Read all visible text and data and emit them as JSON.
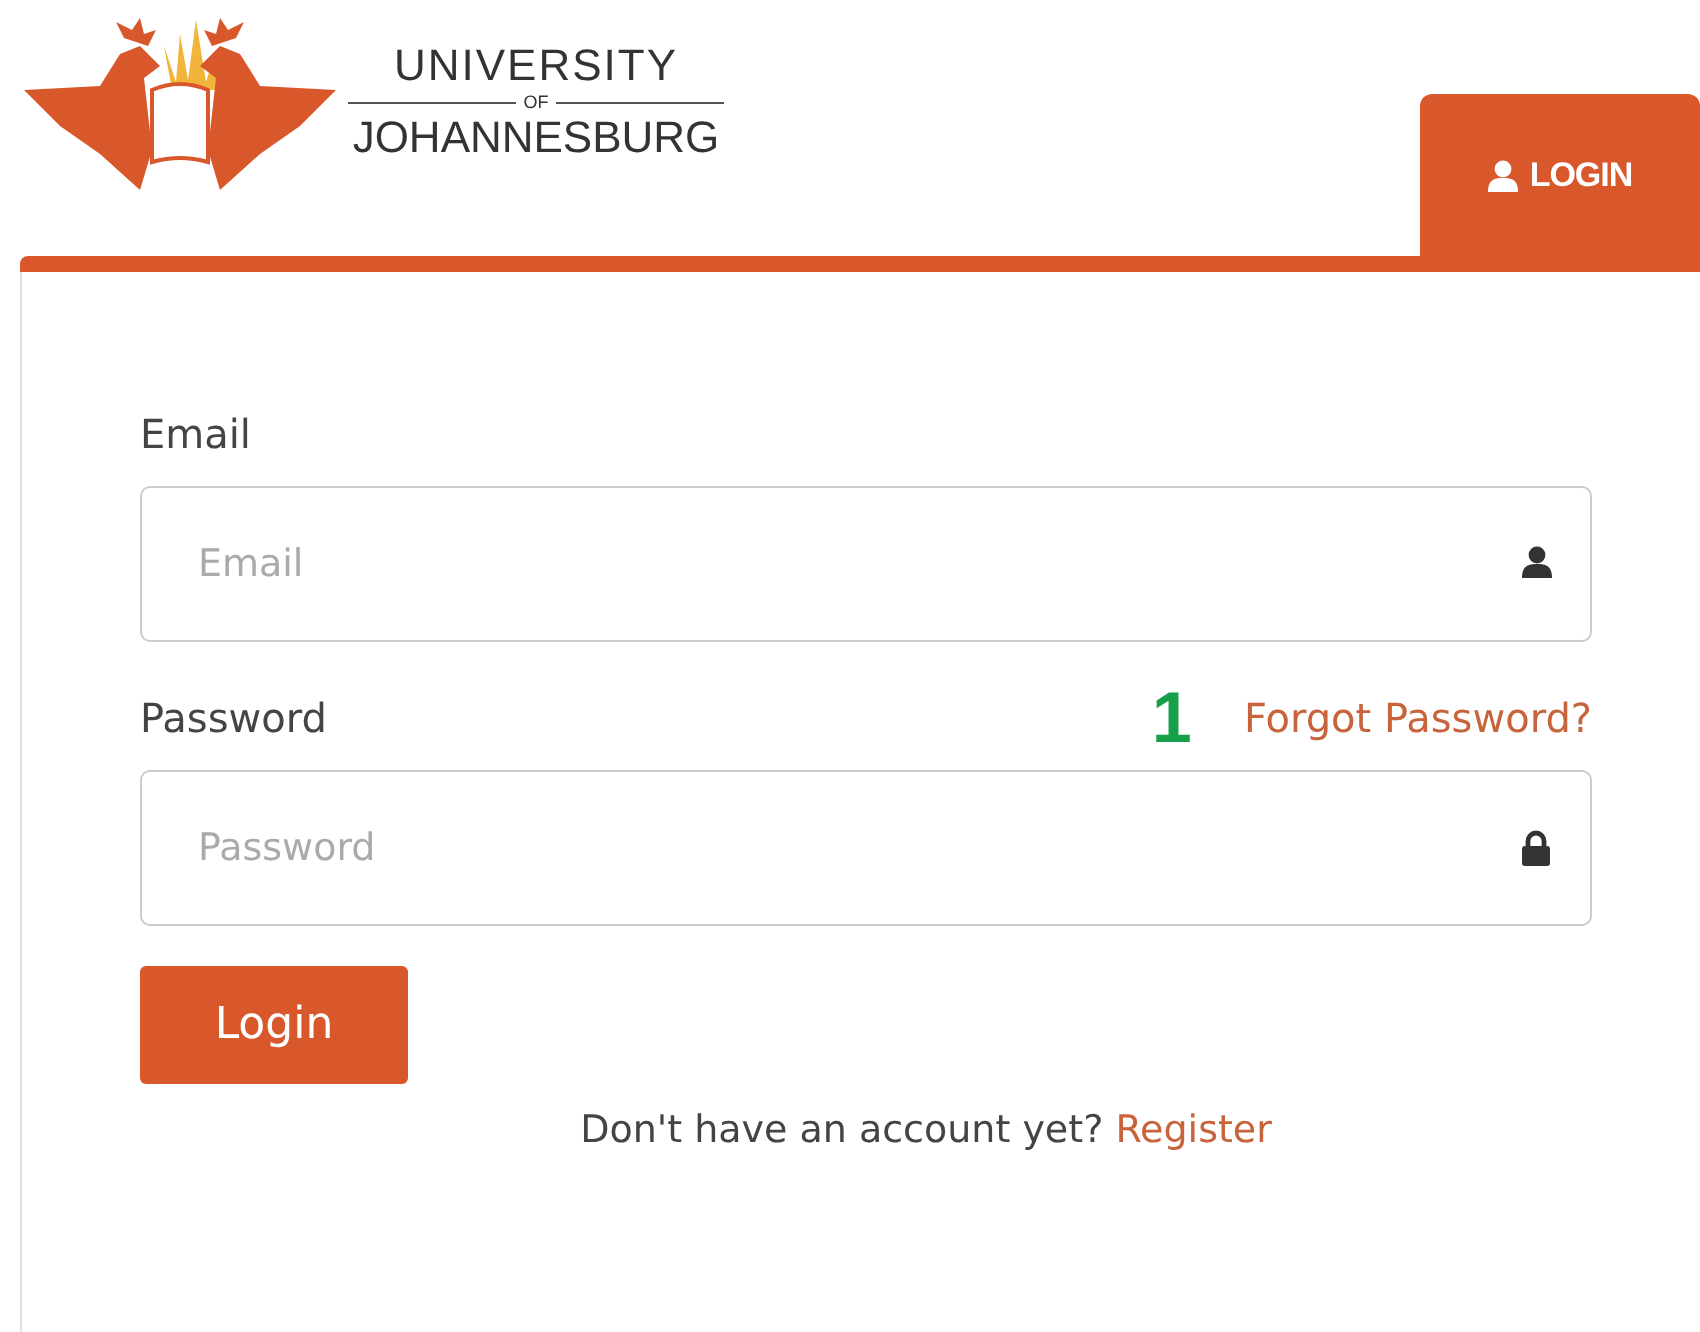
{
  "logo": {
    "line1": "UNIVERSITY",
    "line2": "OF",
    "line3": "JOHANNESBURG"
  },
  "tabs": [
    {
      "label": "LOGIN",
      "selected": true
    }
  ],
  "fields": [
    {
      "label": "Email",
      "placeholder": "Email",
      "kind": "user"
    },
    {
      "label": "Password",
      "placeholder": "Password",
      "kind": "lock",
      "annotation": "1",
      "link": "Forgot Password?"
    }
  ],
  "submit": "Login",
  "footer": {
    "text": "Don't have an account yet?",
    "link": "Register"
  }
}
